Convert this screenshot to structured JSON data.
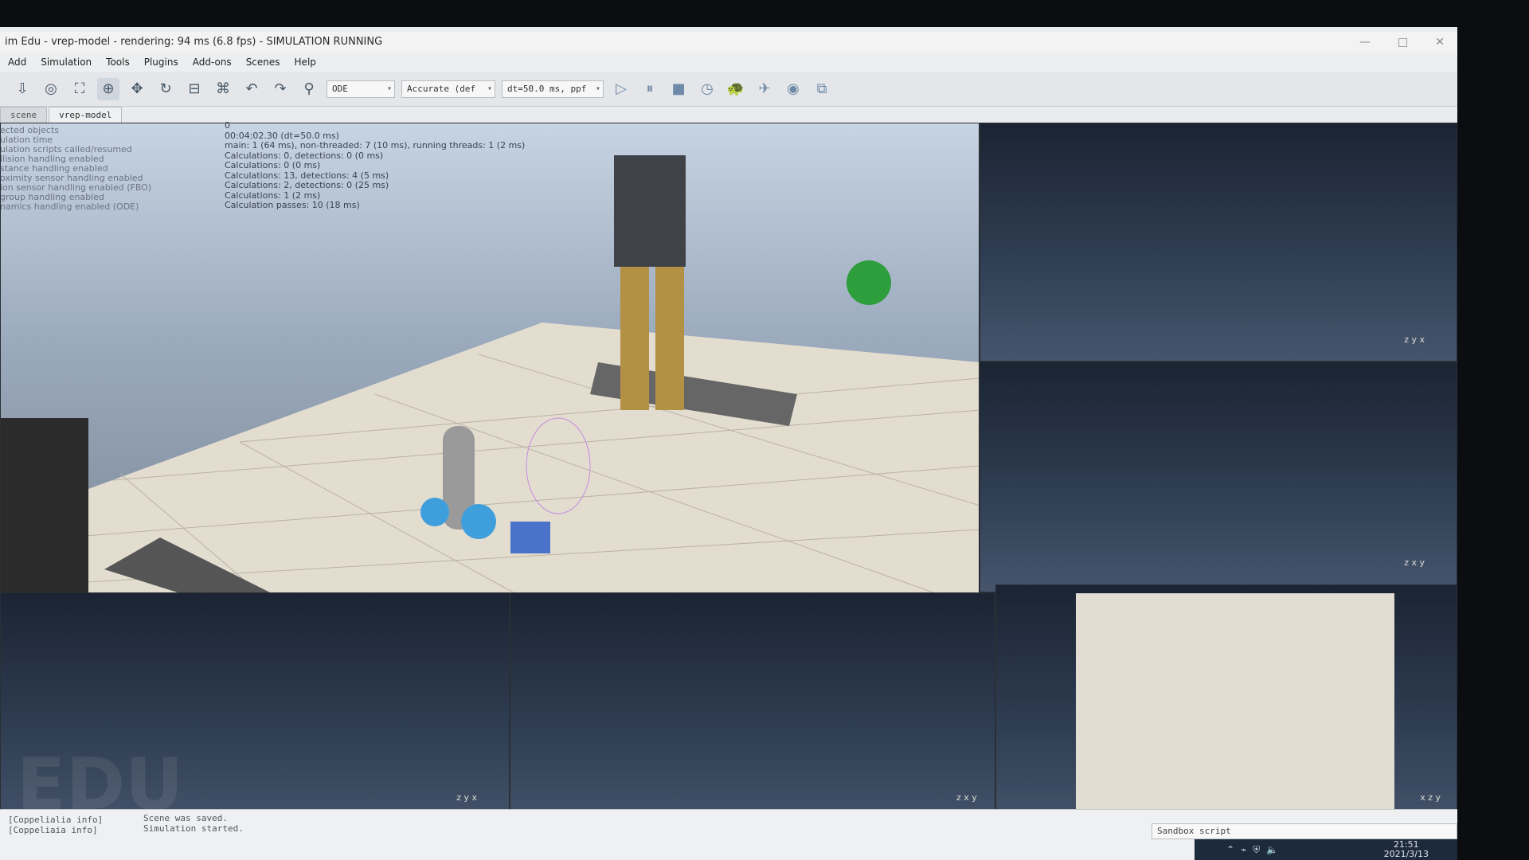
{
  "window": {
    "title": "im Edu - vrep-model - rendering: 94 ms (6.8 fps) - SIMULATION RUNNING",
    "controls": [
      "—",
      "□",
      "✕"
    ]
  },
  "menu": [
    "Add",
    "Simulation",
    "Tools",
    "Plugins",
    "Add-ons",
    "Scenes",
    "Help"
  ],
  "toolbar": {
    "engine": "ODE",
    "accuracy": "Accurate (def",
    "timestep": "dt=50.0 ms, ppf"
  },
  "tabs": [
    "scene",
    "vrep-model"
  ],
  "info": {
    "labels": [
      "ected objects",
      "ulation time",
      "ulation scripts called/resumed",
      "llision handling enabled",
      "stance handling enabled",
      "oximity sensor handling enabled",
      "ion sensor handling enabled (FBO)",
      "group handling enabled",
      "namics handling enabled (ODE)"
    ],
    "values": [
      "0",
      "00:04:02.30 (dt=50.0 ms)",
      "main: 1 (64 ms), non-threaded: 7 (10 ms), running threads: 1 (2 ms)",
      "Calculations: 0, detections: 0 (0 ms)",
      "Calculations: 0 (0 ms)",
      "Calculations: 13, detections: 4 (5 ms)",
      "Calculations: 2, detections: 0 (25 ms)",
      "Calculations: 1 (2 ms)",
      "Calculation passes: 10 (18 ms)"
    ]
  },
  "console": {
    "left": [
      "[Coppelialia info]",
      "[Coppeliaia info]"
    ],
    "messages": [
      "Scene was saved.",
      "Simulation started."
    ],
    "sandbox": "Sandbox script"
  },
  "clock": {
    "time": "21:51",
    "date": "2021/3/13"
  },
  "watermark": "EDU",
  "axes": {
    "z": "z",
    "x": "x",
    "y": "y"
  }
}
